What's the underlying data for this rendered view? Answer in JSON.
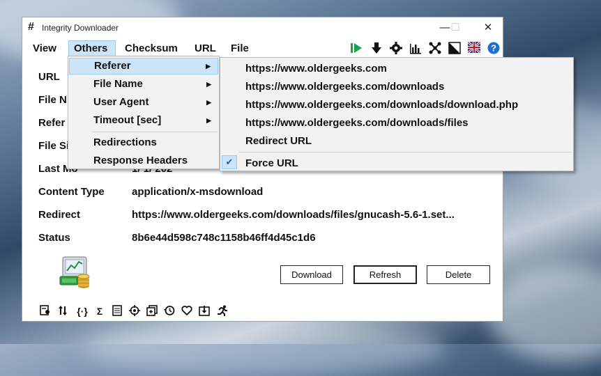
{
  "window": {
    "icon": "#",
    "title": "Integrity Downloader",
    "controls": {
      "minimize": "—",
      "maximize": "☐",
      "close": "✕"
    }
  },
  "menubar": [
    "View",
    "Others",
    "Checksum",
    "URL",
    "File"
  ],
  "toolbar_icons": [
    "play-icon",
    "download-arrow-icon",
    "gear-icon",
    "bar-chart-icon",
    "network-icon",
    "contrast-icon",
    "uk-flag-icon",
    "help-icon"
  ],
  "fields": {
    "url_label": "URL",
    "file_name_label": "File N",
    "referer_label": "Refer",
    "file_size_label": "File Si",
    "last_modified_label": "Last Mo",
    "last_modified_value": "1/ 1/ 202",
    "content_type_label": "Content Type",
    "content_type_value": "application/x-msdownload",
    "redirect_label": "Redirect",
    "redirect_value": "https://www.oldergeeks.com/downloads/files/gnucash-5.6-1.set...",
    "status_label": "Status",
    "status_value": "8b6e44d598c748c1158b46ff4d45c1d6"
  },
  "buttons": {
    "download": "Download",
    "refresh": "Refresh",
    "delete": "Delete"
  },
  "bottom_icons": [
    "certificate-icon",
    "swap-icon",
    "braces-icon",
    "sigma-icon",
    "document-icon",
    "target-icon",
    "add-window-icon",
    "history-icon",
    "heart-icon",
    "import-icon",
    "run-icon"
  ],
  "others_menu": {
    "items": [
      {
        "label": "Referer",
        "submenu": true
      },
      {
        "label": "File Name",
        "submenu": true
      },
      {
        "label": "User Agent",
        "submenu": true
      },
      {
        "label": "Timeout [sec]",
        "submenu": true
      },
      {
        "label": "Redirections",
        "submenu": false
      },
      {
        "label": "Response Headers",
        "submenu": false
      }
    ]
  },
  "referer_submenu": {
    "items": [
      "https://www.oldergeeks.com",
      "https://www.oldergeeks.com/downloads",
      "https://www.oldergeeks.com/downloads/download.php",
      "https://www.oldergeeks.com/downloads/files",
      "Redirect URL"
    ],
    "checked_item": "Force URL"
  },
  "colors": {
    "menu_highlight": "#cce4f7",
    "menu_highlight_border": "#99c9ef",
    "play_green": "#1aa34a",
    "help_blue": "#1e6fd0"
  }
}
